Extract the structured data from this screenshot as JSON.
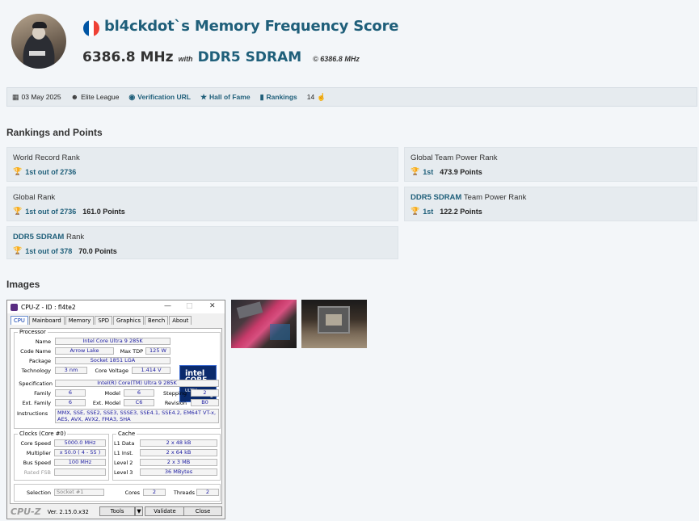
{
  "header": {
    "title": "bl4ckdot`s Memory Frequency Score",
    "frequency": "6386.8 MHz",
    "with_label": "with",
    "memory_type": "DDR5 SDRAM",
    "copyright": "© 6386.8 MHz",
    "flag_colors": [
      "#0055a4",
      "#ffffff",
      "#ef4135"
    ]
  },
  "infobar": {
    "date": "03 May 2025",
    "league": "Elite League",
    "verification": "Verification URL",
    "hall_of_fame": "Hall of Fame",
    "rankings": "Rankings",
    "likes": "14"
  },
  "rankings": {
    "title": "Rankings and Points",
    "world_record": {
      "label": "World Record Rank",
      "rank": "1st out of 2736"
    },
    "global_team": {
      "label": "Global Team Power Rank",
      "rank": "1st",
      "points": "473.9 Points"
    },
    "global": {
      "label": "Global Rank",
      "rank": "1st out of 2736",
      "points": "161.0 Points"
    },
    "ddr5_team": {
      "hl": "DDR5 SDRAM",
      "label": "Team Power Rank",
      "rank": "1st",
      "points": "122.2 Points"
    },
    "ddr5": {
      "hl": "DDR5 SDRAM",
      "label": "Rank",
      "rank": "1st out of 378",
      "points": "70.0 Points"
    }
  },
  "images": {
    "title": "Images"
  },
  "cpuz": {
    "window_title": "CPU-Z  - ID : fl4te2",
    "tabs": [
      "CPU",
      "Mainboard",
      "Memory",
      "SPD",
      "Graphics",
      "Bench",
      "About"
    ],
    "processor": {
      "group": "Processor",
      "name_label": "Name",
      "name": "Intel Core Ultra 9 285K",
      "codename_label": "Code Name",
      "codename": "Arrow Lake",
      "tdp_label": "Max TDP",
      "tdp": "125 W",
      "package_label": "Package",
      "package": "Socket 1851 LGA",
      "tech_label": "Technology",
      "tech": "3 nm",
      "voltage_label": "Core Voltage",
      "voltage": "1.414 V",
      "spec_label": "Specification",
      "spec": "Intel(R) Core(TM) Ultra 9 285K",
      "family_label": "Family",
      "family": "6",
      "model_label": "Model",
      "model": "6",
      "stepping_label": "Stepping",
      "stepping": "2",
      "extfamily_label": "Ext. Family",
      "extfamily": "6",
      "extmodel_label": "Ext. Model",
      "extmodel": "C6",
      "revision_label": "Revision",
      "revision": "B0",
      "instr_label": "Instructions",
      "instructions": "MMX, SSE, SSE2, SSE3, SSSE3, SSE4.1, SSE4.2, EM64T VT-x, AES, AVX, AVX2, FMA3, SHA",
      "logo_brand": "intel",
      "logo_core": "CORE",
      "logo_ultra": "ULTRA",
      "logo_num": "9"
    },
    "clocks": {
      "group": "Clocks (Core #0)",
      "speed_label": "Core Speed",
      "speed": "5000.0 MHz",
      "mult_label": "Multiplier",
      "mult": "x 50.0 ( 4 - 55 )",
      "bus_label": "Bus Speed",
      "bus": "100 MHz",
      "fsb_label": "Rated FSB",
      "fsb": ""
    },
    "cache": {
      "group": "Cache",
      "l1d_label": "L1 Data",
      "l1d": "2 x 48 kB",
      "l1i_label": "L1 Inst.",
      "l1i": "2 x 64 kB",
      "l2_label": "Level 2",
      "l2": "2 x 3 MB",
      "l3_label": "Level 3",
      "l3": "36 MBytes"
    },
    "selection_label": "Selection",
    "selection": "Socket #1",
    "cores_label": "Cores",
    "cores": "2",
    "threads_label": "Threads",
    "threads": "2",
    "logo": "CPU-Z",
    "version": "Ver. 2.15.0.x32",
    "tools": "Tools",
    "validate": "Validate",
    "close": "Close"
  }
}
